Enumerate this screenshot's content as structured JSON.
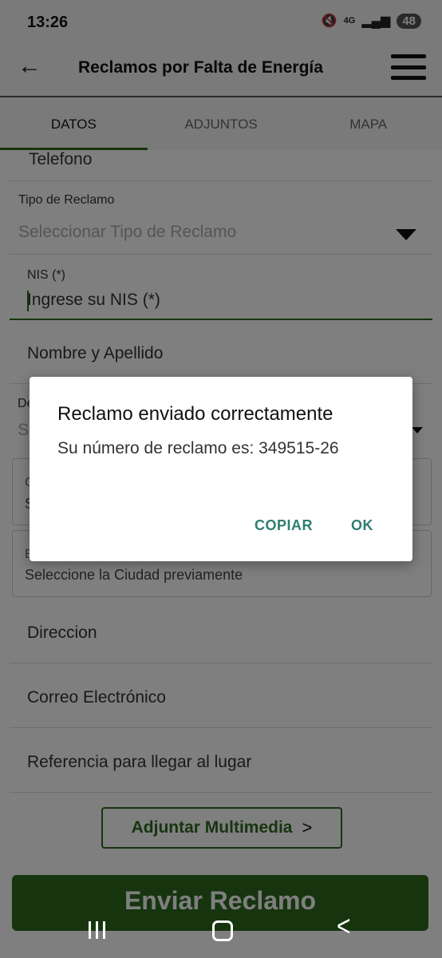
{
  "status_bar": {
    "time": "13:26",
    "network_label": "4G",
    "battery": "48"
  },
  "app_bar": {
    "title": "Reclamos por Falta de Energía"
  },
  "tabs": [
    {
      "label": "DATOS",
      "active": true
    },
    {
      "label": "ADJUNTOS",
      "active": false
    },
    {
      "label": "MAPA",
      "active": false
    }
  ],
  "form": {
    "telefono_label": "Telefono",
    "tipo_reclamo": {
      "label": "Tipo de Reclamo",
      "placeholder": "Seleccionar Tipo de Reclamo"
    },
    "nis": {
      "label": "NIS (*)",
      "placeholder": "Ingrese su NIS (*)"
    },
    "nombre_placeholder": "Nombre y Apellido",
    "departamento_label_partial": "De",
    "departamento_value_partial": "S",
    "ciudad_label_partial": "C",
    "ciudad_value_partial": "S",
    "barrio_label_partial": "B",
    "barrio_value": "Seleccione la Ciudad previamente",
    "direccion_placeholder": "Direccion",
    "correo_placeholder": "Correo Electrónico",
    "referencia_placeholder": "Referencia para llegar al lugar",
    "adjuntar_button": "Adjuntar Multimedia",
    "enviar_button": "Enviar Reclamo"
  },
  "dialog": {
    "title": "Reclamo enviado correctamente",
    "message": "Su número de reclamo es: 349515-26",
    "copy_button": "COPIAR",
    "ok_button": "OK"
  },
  "colors": {
    "accent_green": "#2d6a1e",
    "dialog_button_teal": "#2f7d72"
  }
}
